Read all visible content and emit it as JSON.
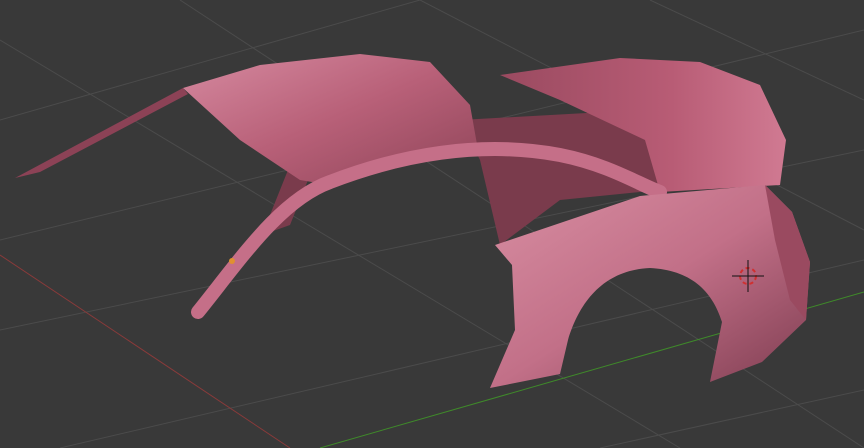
{
  "viewport": {
    "mode": "3d-viewport",
    "object": "car-body-mesh"
  },
  "colors": {
    "background": "#393939",
    "grid": "#4b4b4b",
    "x_axis": "#8a3a3a",
    "y_axis": "#3f8a2a",
    "mesh_base": "#c0677f",
    "mesh_light": "#d98ca0",
    "mesh_dark": "#7a3b4c",
    "origin_dot": "#e09030",
    "cursor_ring": "#d03030"
  }
}
